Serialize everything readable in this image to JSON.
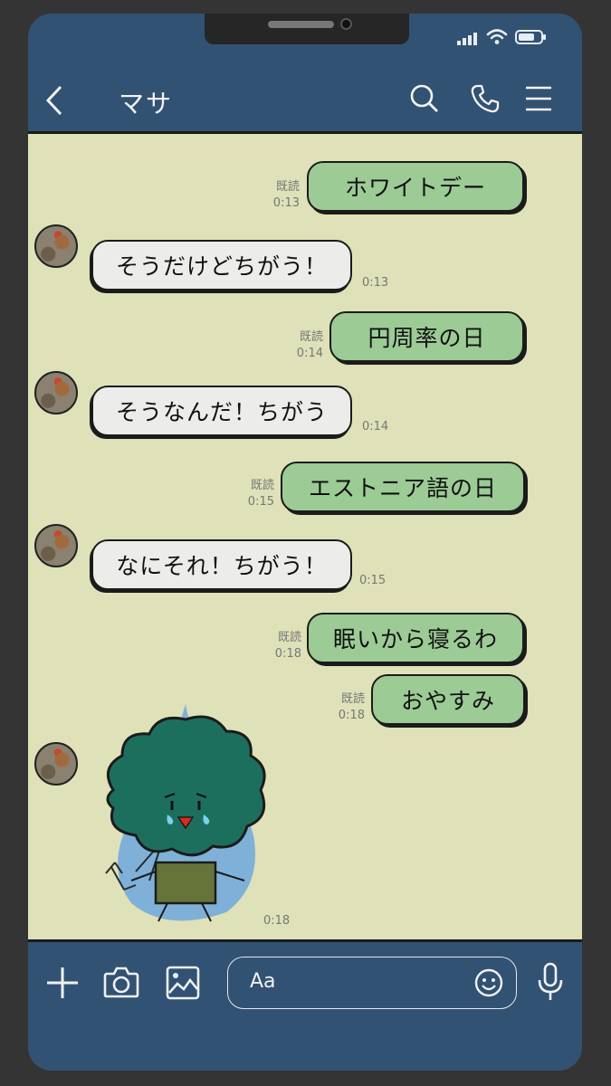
{
  "header": {
    "contact_name": "マサ"
  },
  "messages": [
    {
      "side": "out",
      "text": "ホワイトデー",
      "read": "既読",
      "time": "0:13"
    },
    {
      "side": "in",
      "text": "そうだけどちがう！",
      "time": "0:13"
    },
    {
      "side": "out",
      "text": "円周率の日",
      "read": "既読",
      "time": "0:14"
    },
    {
      "side": "in",
      "text": "そうなんだ！ちがう",
      "time": "0:14"
    },
    {
      "side": "out",
      "text": "エストニア語の日",
      "read": "既読",
      "time": "0:15"
    },
    {
      "side": "in",
      "text": "なにそれ！ちがう！",
      "time": "0:15"
    },
    {
      "side": "out",
      "text": "眠いから寝るわ",
      "read": "既読",
      "time": "0:18"
    },
    {
      "side": "out",
      "text": "おやすみ",
      "read": "既読",
      "time": "0:18"
    },
    {
      "side": "in",
      "type": "sticker",
      "sticker": "crying-broccoli-sticker",
      "time": "0:18"
    }
  ],
  "composer": {
    "placeholder": "Aa"
  },
  "icons": {
    "back": "chevron-left-icon",
    "search": "search-icon",
    "call": "phone-icon",
    "menu": "menu-icon",
    "plus": "plus-icon",
    "camera": "camera-icon",
    "image": "image-icon",
    "emoji": "emoji-icon",
    "mic": "microphone-icon"
  },
  "colors": {
    "frame": "#325273",
    "chat_bg": "#dfe1b8",
    "out_bubble": "#9ccb96",
    "in_bubble": "#ececeb"
  }
}
